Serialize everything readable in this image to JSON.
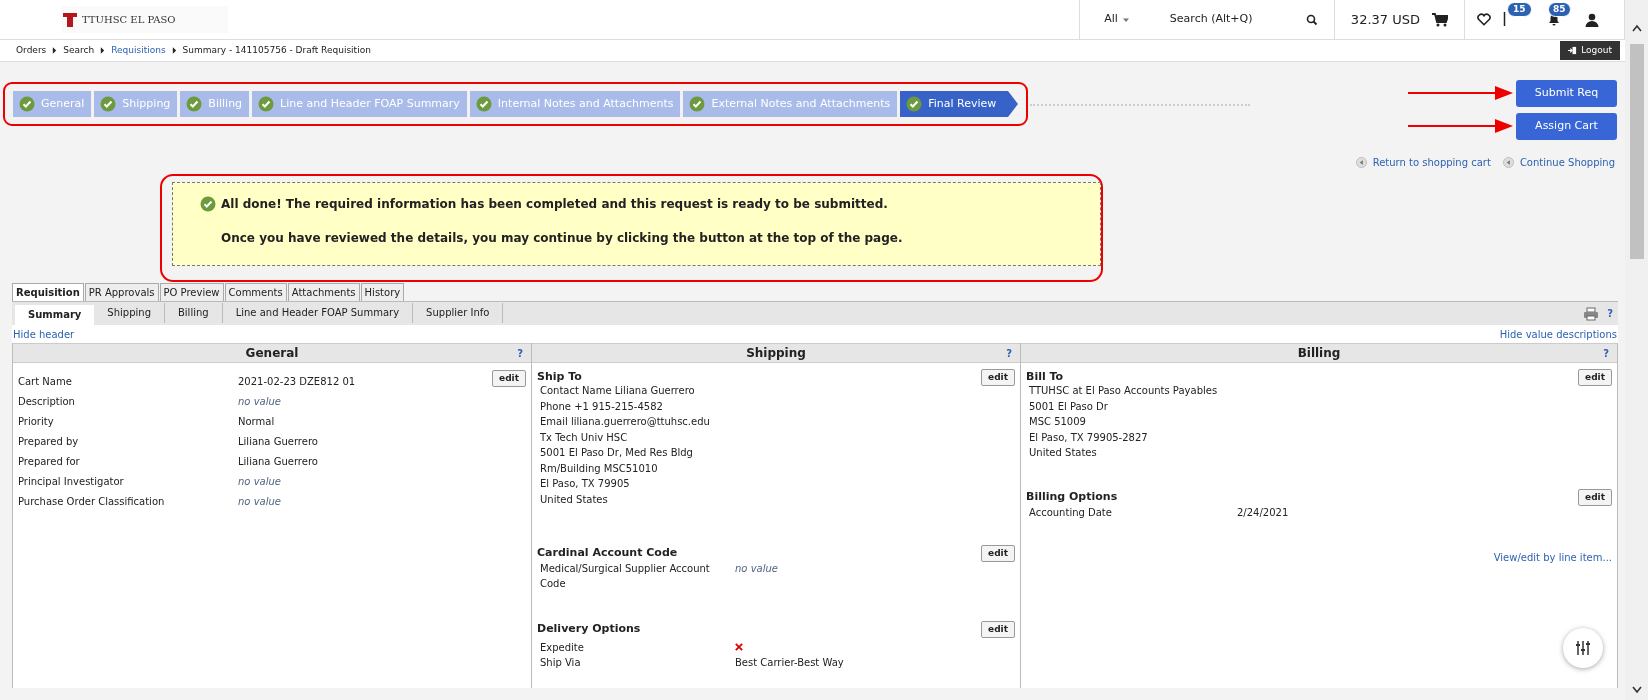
{
  "header": {
    "logo_text": "TTUHSC EL PASO",
    "search_scope": "All",
    "search_placeholder": "Search (Alt+Q)",
    "cart_total": "32.37 USD",
    "flag_count": "15",
    "bell_count": "85"
  },
  "breadcrumb": [
    {
      "label": "Orders",
      "link": false
    },
    {
      "label": "Search",
      "link": false
    },
    {
      "label": "Requisitions",
      "link": true
    },
    {
      "label": "Summary - 141105756 - Draft Requisition",
      "link": false
    }
  ],
  "logout": "Logout",
  "steps": [
    {
      "label": "General",
      "complete": true,
      "selected": false
    },
    {
      "label": "Shipping",
      "complete": true,
      "selected": false
    },
    {
      "label": "Billing",
      "complete": true,
      "selected": false
    },
    {
      "label": "Line and Header FOAP Summary",
      "complete": true,
      "selected": false
    },
    {
      "label": "Internal Notes and Attachments",
      "complete": true,
      "selected": false
    },
    {
      "label": "External Notes and Attachments",
      "complete": true,
      "selected": false
    },
    {
      "label": "Final Review",
      "complete": true,
      "selected": true
    }
  ],
  "actions": [
    "Submit Req",
    "Assign Cart"
  ],
  "links": [
    "Return to shopping cart",
    "Continue Shopping"
  ],
  "notice": {
    "title": "All done! The required information has been completed and this request is ready to be submitted.",
    "body": "Once you have reviewed the details, you may continue by clicking the button at the top of the page."
  },
  "tabs": [
    {
      "label": "Requisition",
      "selected": true
    },
    {
      "label": "PR Approvals",
      "selected": false
    },
    {
      "label": "PO Preview",
      "selected": false
    },
    {
      "label": "Comments",
      "selected": false
    },
    {
      "label": "Attachments",
      "selected": false
    },
    {
      "label": "History",
      "selected": false
    }
  ],
  "subtabs": [
    {
      "label": "Summary",
      "selected": true
    },
    {
      "label": "Shipping",
      "selected": false
    },
    {
      "label": "Billing",
      "selected": false
    },
    {
      "label": "Line and Header FOAP Summary",
      "selected": false
    },
    {
      "label": "Supplier Info",
      "selected": false
    }
  ],
  "hide_header": "Hide header",
  "hide_descriptions": "Hide value descriptions",
  "help": "?",
  "general": {
    "title": "General",
    "help": "?",
    "edit": "edit",
    "fields": [
      {
        "label": "Cart Name",
        "value": "2021-02-23 DZE812 01",
        "kind": "value"
      },
      {
        "label": "Description",
        "value": "no value",
        "kind": "empty"
      },
      {
        "label": "Priority",
        "value": "Normal",
        "kind": "value"
      },
      {
        "label": "Prepared by",
        "value": "Liliana Guerrero",
        "kind": "value"
      },
      {
        "label": "Prepared for",
        "value": "Liliana Guerrero",
        "kind": "value"
      },
      {
        "label": "Principal Investigator",
        "value": "no value",
        "kind": "empty"
      },
      {
        "label": "Purchase Order Classification",
        "value": "no value",
        "kind": "empty"
      }
    ]
  },
  "shipping": {
    "title": "Shipping",
    "help": "?",
    "ship_to": {
      "title": "Ship To",
      "edit": "edit",
      "lines": [
        "Contact Name Liliana Guerrero",
        "Phone +1 915-215-4582",
        "Email liliana.guerrero@ttuhsc.edu",
        "Tx Tech Univ HSC",
        "5001 El Paso Dr, Med Res Bldg",
        "Rm/Building MSC51010",
        "El Paso, TX 79905",
        "United States"
      ]
    },
    "cardinal": {
      "title": "Cardinal Account Code",
      "edit": "edit",
      "label": "Medical/Surgical Supplier Account Code",
      "value": "no value",
      "kind": "empty"
    },
    "delivery": {
      "title": "Delivery Options",
      "edit": "edit",
      "expedite_label": "Expedite",
      "expedite": false,
      "ship_via_label": "Ship Via",
      "ship_via": "Best Carrier-Best Way"
    }
  },
  "billing": {
    "title": "Billing",
    "help": "?",
    "bill_to": {
      "title": "Bill To",
      "edit": "edit",
      "lines": [
        "TTUHSC at El Paso Accounts Payables",
        "5001 El Paso Dr",
        "MSC 51009",
        "El Paso, TX 79905-2827",
        "United States"
      ]
    },
    "options": {
      "title": "Billing Options",
      "edit": "edit",
      "label": "Accounting Date",
      "value": "2/24/2021"
    },
    "line_link": "View/edit by line item..."
  }
}
